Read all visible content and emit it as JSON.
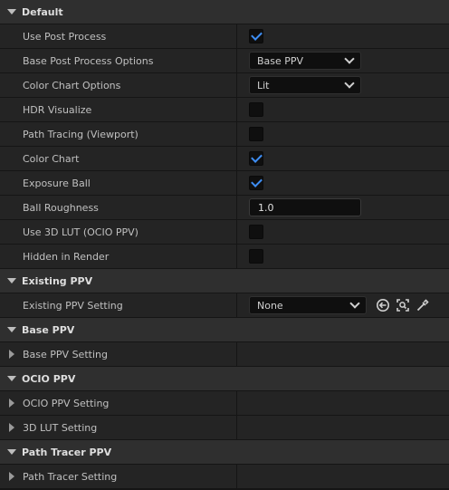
{
  "categories": {
    "default": "Default",
    "existing_ppv": "Existing PPV",
    "base_ppv": "Base PPV",
    "ocio_ppv": "OCIO PPV",
    "path_tracer_ppv": "Path Tracer PPV"
  },
  "rows": {
    "use_post_process": {
      "label": "Use Post Process",
      "checked": true
    },
    "base_post_process_options": {
      "label": "Base Post Process Options",
      "value": "Base PPV"
    },
    "color_chart_options": {
      "label": "Color Chart Options",
      "value": "Lit"
    },
    "hdr_visualize": {
      "label": "HDR Visualize",
      "checked": false
    },
    "path_tracing_viewport": {
      "label": "Path Tracing (Viewport)",
      "checked": false
    },
    "color_chart": {
      "label": "Color Chart",
      "checked": true
    },
    "exposure_ball": {
      "label": "Exposure Ball",
      "checked": true
    },
    "ball_roughness": {
      "label": "Ball Roughness",
      "value": "1.0"
    },
    "use_3d_lut": {
      "label": "Use 3D LUT (OCIO PPV)",
      "checked": false
    },
    "hidden_in_render": {
      "label": "Hidden in Render",
      "checked": false
    },
    "existing_ppv_setting": {
      "label": "Existing PPV Setting",
      "value": "None"
    },
    "base_ppv_setting": {
      "label": "Base PPV Setting"
    },
    "ocio_ppv_setting": {
      "label": "OCIO PPV Setting"
    },
    "lut_setting": {
      "label": "3D LUT Setting"
    },
    "path_tracer_setting": {
      "label": "Path Tracer Setting"
    }
  },
  "icons": {
    "use_selected": "arrow-left-circle-icon",
    "browse": "browse-target-icon",
    "picker": "eyedropper-icon"
  },
  "colors": {
    "accent": "#3e8ef5",
    "row_bg": "#242424",
    "category_bg": "#2f2f2f"
  }
}
